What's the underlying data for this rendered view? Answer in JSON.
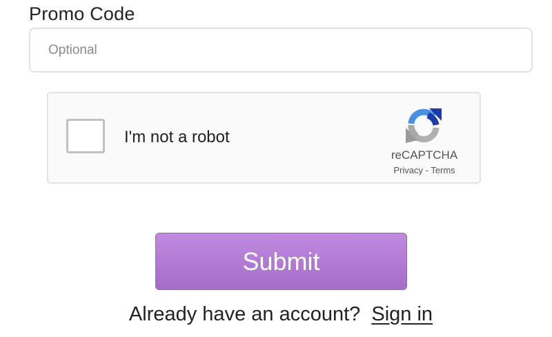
{
  "promo": {
    "label": "Promo Code",
    "placeholder": "Optional",
    "value": ""
  },
  "captcha": {
    "label": "I'm not a robot",
    "brand": "reCAPTCHA",
    "privacy_label": "Privacy",
    "separator": " - ",
    "terms_label": "Terms",
    "checked": false,
    "logo_icon": "recaptcha-logo-icon",
    "colors": {
      "blue": "#1c3aa9",
      "light_blue": "#4a90e2",
      "gray": "#b0b0b0"
    }
  },
  "form": {
    "submit_label": "Submit",
    "submit_color": "#b07ad6"
  },
  "account": {
    "prompt": "Already have an account?  ",
    "signin_label": "Sign in"
  }
}
